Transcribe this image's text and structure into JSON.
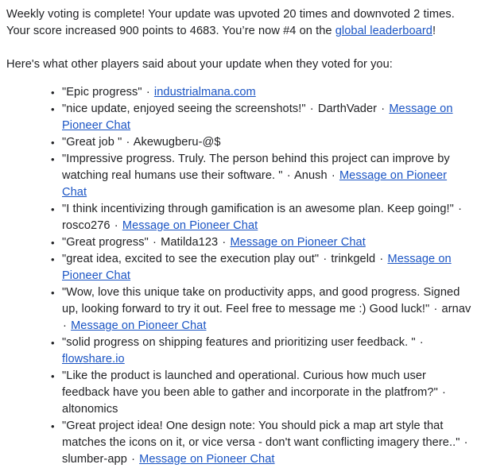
{
  "summary": {
    "line1": "Weekly voting is complete! Your update was upvoted 20 times and downvoted 2 times.",
    "line2_before_link": "Your score increased 900 points to 4683. You’re now #4 on the ",
    "leaderboard_link": "global leaderboard",
    "line2_after_link": "!",
    "upvotes": 20,
    "downvotes": 2,
    "points_gained": 900,
    "new_score": 4683,
    "rank": 4
  },
  "intro": "Here's what other players said about your update when they voted for you:",
  "separator": "·",
  "chat_link_label": "Message on Pioneer Chat",
  "comments": [
    {
      "quote": "\"Epic progress\"",
      "author": "",
      "link": "industrialmana.com",
      "link_type": "site"
    },
    {
      "quote": "\"nice update, enjoyed seeing the screenshots!\"",
      "author": "DarthVader",
      "link": "Message on Pioneer Chat",
      "link_type": "chat"
    },
    {
      "quote": "\"Great job \"",
      "author": "Akewugberu-@$",
      "link": "",
      "link_type": "none"
    },
    {
      "quote": "\"Impressive progress. Truly. The person behind this project can improve by watching real humans use their software. \"",
      "author": "Anush",
      "link": "Message on Pioneer Chat",
      "link_type": "chat"
    },
    {
      "quote": "\"I think incentivizing through gamification is an awesome plan. Keep going!\"",
      "author": "rosco276",
      "link": "Message on Pioneer Chat",
      "link_type": "chat"
    },
    {
      "quote": "\"Great progress\"",
      "author": "Matilda123",
      "link": "Message on Pioneer Chat",
      "link_type": "chat"
    },
    {
      "quote": "\"great idea, excited to see the execution play out\"",
      "author": "trinkgeld",
      "link": "Message on Pioneer Chat",
      "link_type": "chat"
    },
    {
      "quote": "\"Wow, love this unique take on productivity apps, and good progress. Signed up, looking forward to try it out. Feel free to message me :) Good luck!\"",
      "author": "arnav",
      "link": "Message on Pioneer Chat",
      "link_type": "chat"
    },
    {
      "quote": "\"solid progress on shipping features and prioritizing user feedback. \"",
      "author": "",
      "link": "flowshare.io",
      "link_type": "site"
    },
    {
      "quote": "\"Like the product is launched and operational. Curious how much user feedback have you been able to gather and incorporate in the platfrom?\"",
      "author": "altonomics",
      "link": "",
      "link_type": "none"
    },
    {
      "quote": "\"Great project idea! One design note: You should pick a map art style that matches the icons on it, or vice versa - don't want conflicting imagery there..\"",
      "author": "slumber-app",
      "link": "Message on Pioneer Chat",
      "link_type": "chat"
    }
  ],
  "colors": {
    "text": "#202124",
    "link": "#1a54c4",
    "background": "#ffffff"
  }
}
